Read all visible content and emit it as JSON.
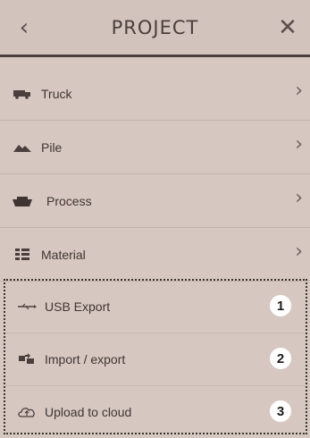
{
  "header": {
    "back_icon": "chevron-left-icon",
    "title": "PROJECT",
    "close_icon": "close-icon"
  },
  "menu": {
    "items": [
      {
        "label": "Truck",
        "icon": "truck-icon"
      },
      {
        "label": "Pile",
        "icon": "pile-icon"
      },
      {
        "label": "Process",
        "icon": "bowl-icon"
      },
      {
        "label": "Material",
        "icon": "material-icon"
      }
    ]
  },
  "export_section": {
    "items": [
      {
        "label": "USB Export",
        "icon": "usb-icon",
        "badge": "1"
      },
      {
        "label": "Import / export",
        "icon": "import-export-icon",
        "badge": "2"
      },
      {
        "label": "Upload to cloud",
        "icon": "cloud-upload-icon",
        "badge": "3"
      }
    ]
  }
}
